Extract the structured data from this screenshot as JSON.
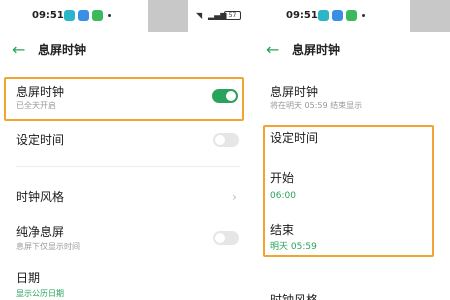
{
  "left": {
    "status": {
      "time": "09:51",
      "battery": "57"
    },
    "header": {
      "title": "息屏时钟"
    },
    "aod_row": {
      "title": "息屏时钟",
      "subtitle": "已全天开启"
    },
    "set_time_row": {
      "title": "设定时间"
    },
    "clock_style_row": {
      "title": "时钟风格"
    },
    "pure_aod_row": {
      "title": "纯净息屏",
      "subtitle": "息屏下仅显示时间"
    },
    "date_row": {
      "title": "日期",
      "subtitle": "显示公历日期"
    }
  },
  "right": {
    "status": {
      "time": "09:51",
      "battery": "57"
    },
    "header": {
      "title": "息屏时钟"
    },
    "aod_row": {
      "title": "息屏时钟",
      "subtitle": "将在明天 05:59 结束显示"
    },
    "set_time": {
      "title": "设定时间",
      "start_label": "开始",
      "start_value": "06:00",
      "end_label": "结束",
      "end_value": "明天 05:59"
    },
    "clock_style_row": {
      "title": "时钟风格"
    }
  },
  "colors": {
    "accent": "#27a35b",
    "highlight": "#f0a530",
    "toggle_off": "#e6e6e6"
  },
  "toggles": {
    "aod": true,
    "set_time": false,
    "pure_aod": false
  }
}
